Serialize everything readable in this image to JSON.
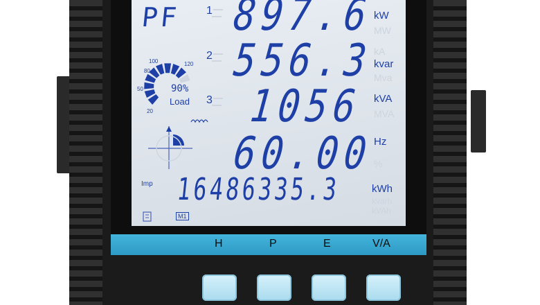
{
  "display": {
    "mode_label": "PF",
    "rows": [
      {
        "index": "1",
        "value": "897.6",
        "unit": "kW"
      },
      {
        "index": "2",
        "value": "556.3",
        "unit": "kvar"
      },
      {
        "index": "3",
        "value": "1056",
        "unit": "kVA"
      },
      {
        "index": "",
        "value": "60.00",
        "unit": "Hz"
      }
    ],
    "ghost_units": [
      "MW",
      "kA",
      "Mva",
      "MVA",
      "%",
      "kvarh",
      "kVAh"
    ],
    "load_gauge": {
      "ticks": [
        "20",
        "50",
        "80",
        "100",
        "120"
      ],
      "percent": "90%",
      "label": "Load",
      "level": 0.9
    },
    "energy": {
      "direction": "Imp",
      "value": "16486335.3",
      "unit": "kWh"
    },
    "mode_badge": "M1"
  },
  "keys": [
    "H",
    "P",
    "E",
    "V/A"
  ],
  "colors": {
    "lcd_segment": "#1d3fa6",
    "lcd_background": "#e3e8ee",
    "strip": "#39a8d2",
    "button": "#bfe7f6",
    "housing": "#1b1b1b"
  }
}
